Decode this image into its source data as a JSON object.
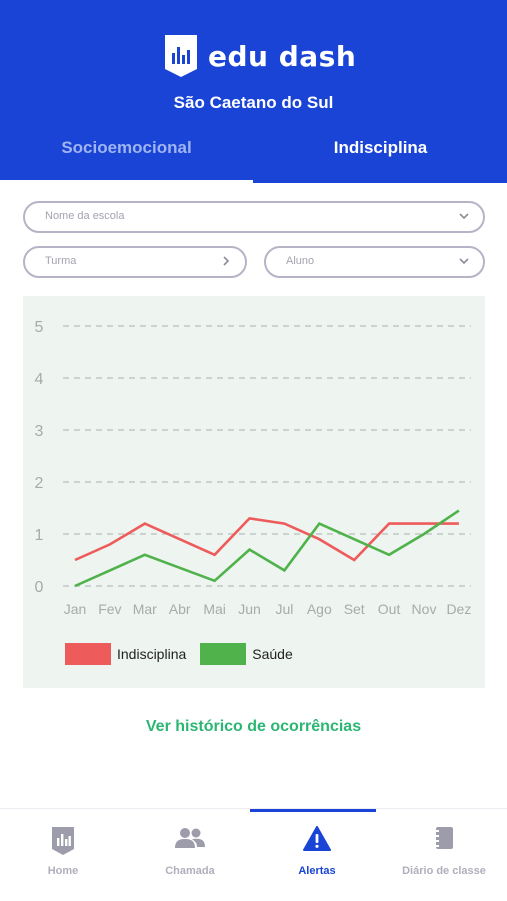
{
  "header": {
    "brand": "edu dash",
    "city": "São Caetano do Sul",
    "tabs": [
      {
        "label": "Socioemocional",
        "active": false
      },
      {
        "label": "Indisciplina",
        "active": true
      }
    ]
  },
  "filters": {
    "school_placeholder": "Nome da escola",
    "turma_placeholder": "Turma",
    "aluno_placeholder": "Aluno"
  },
  "chart_data": {
    "type": "line",
    "categories": [
      "Jan",
      "Fev",
      "Mar",
      "Abr",
      "Mai",
      "Jun",
      "Jul",
      "Ago",
      "Set",
      "Out",
      "Nov",
      "Dez"
    ],
    "series": [
      {
        "name": "Indisciplina",
        "color": "#ee5b5b",
        "values": [
          0.5,
          0.8,
          1.2,
          0.9,
          0.6,
          1.3,
          1.2,
          0.9,
          0.5,
          1.2,
          1.2,
          1.2
        ]
      },
      {
        "name": "Saúde",
        "color": "#4fb24b",
        "values": [
          0.0,
          0.3,
          0.6,
          0.35,
          0.1,
          0.7,
          0.3,
          1.2,
          0.9,
          0.6,
          1.0,
          1.45
        ]
      }
    ],
    "y_ticks": [
      "0",
      "1",
      "2",
      "3",
      "4",
      "5"
    ],
    "ylim": [
      0,
      5
    ],
    "grid": true,
    "legend_position": "bottom-left"
  },
  "history_link": "Ver histórico de ocorrências",
  "bottom_nav": [
    {
      "label": "Home",
      "icon": "chart-badge-icon",
      "active": false
    },
    {
      "label": "Chamada",
      "icon": "people-icon",
      "active": false
    },
    {
      "label": "Alertas",
      "icon": "warning-icon",
      "active": true
    },
    {
      "label": "Diário de classe",
      "icon": "notebook-icon",
      "active": false
    }
  ],
  "colors": {
    "primary": "#1a44d6",
    "link": "#2bb673",
    "chart_bg": "#eef4ef"
  }
}
